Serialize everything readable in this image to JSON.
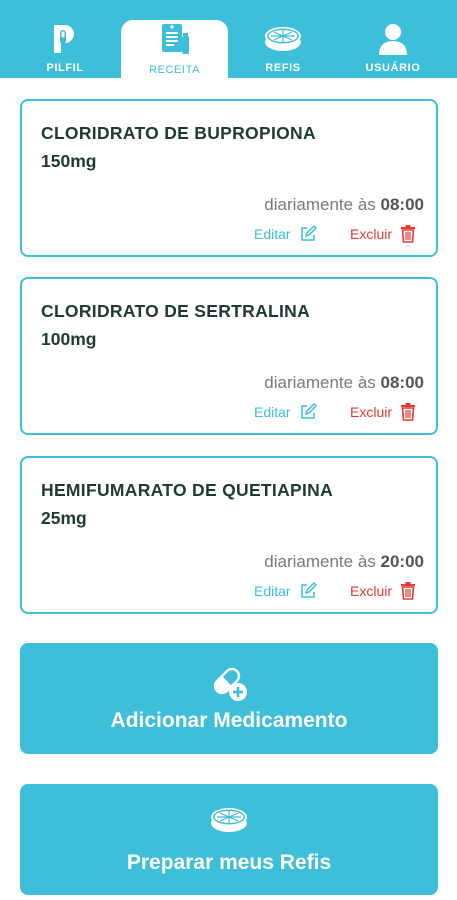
{
  "tabs": [
    {
      "id": "pilfil",
      "label": "PILFIL",
      "icon": "pilfil-logo-icon",
      "active": false
    },
    {
      "id": "receita",
      "label": "RECEITA",
      "icon": "prescription-icon",
      "active": true
    },
    {
      "id": "refis",
      "label": "REFIS",
      "icon": "pill-case-icon",
      "active": false
    },
    {
      "id": "usuario",
      "label": "USUÁRIO",
      "icon": "user-icon",
      "active": false
    }
  ],
  "medications": [
    {
      "name": "CLORIDRATO DE BUPROPIONA",
      "dose": "150mg",
      "schedule_prefix": "diariamente às",
      "time": "08:00",
      "edit_label": "Editar",
      "delete_label": "Excluir"
    },
    {
      "name": "CLORIDRATO DE SERTRALINA",
      "dose": "100mg",
      "schedule_prefix": "diariamente às",
      "time": "08:00",
      "edit_label": "Editar",
      "delete_label": "Excluir"
    },
    {
      "name": "HEMIFUMARATO DE QUETIAPINA",
      "dose": "25mg",
      "schedule_prefix": "diariamente às",
      "time": "20:00",
      "edit_label": "Editar",
      "delete_label": "Excluir"
    }
  ],
  "actions": {
    "add_medication": {
      "label": "Adicionar Medicamento",
      "icon": "add-pill-icon"
    },
    "prepare_refills": {
      "label": "Preparar meus Refis",
      "icon": "pill-case-icon"
    }
  },
  "colors": {
    "accent": "#3dbfd9",
    "text_dark": "#1f3a33",
    "delete": "#e53935",
    "muted": "#7a7a7a"
  }
}
